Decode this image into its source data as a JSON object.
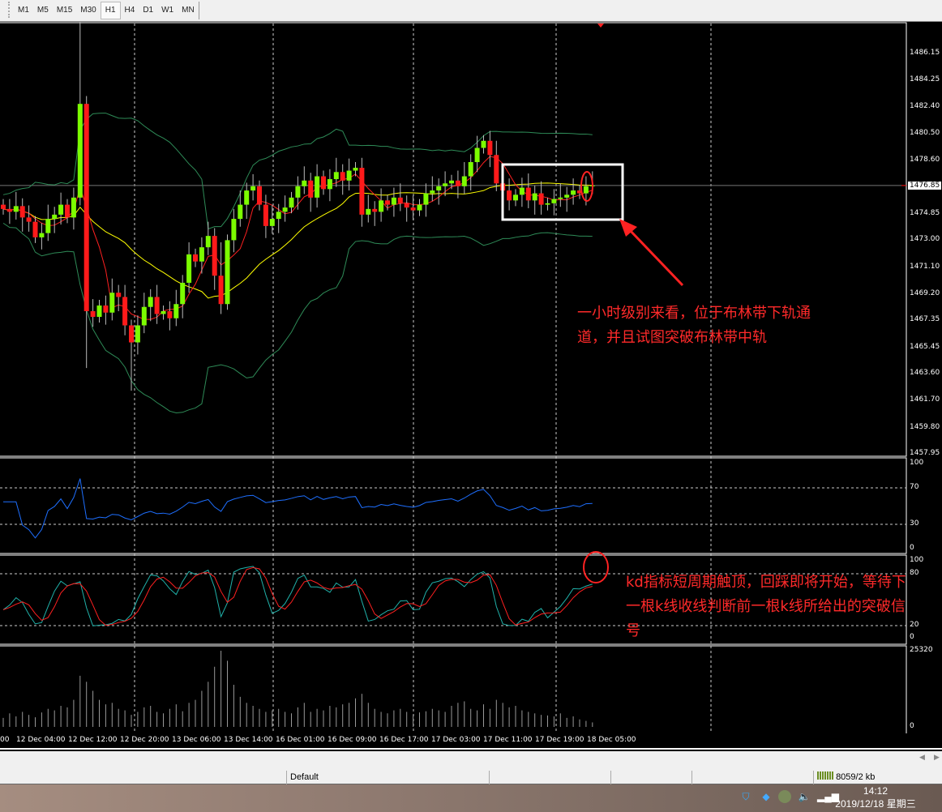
{
  "toolbar": {
    "timeframes": [
      "M1",
      "M5",
      "M15",
      "M30",
      "H1",
      "H4",
      "D1",
      "W1",
      "MN"
    ],
    "active": "H1"
  },
  "price_axis": {
    "labels": [
      "1486.15",
      "1484.25",
      "1482.40",
      "1480.50",
      "1478.60",
      "1474.85",
      "1473.00",
      "1471.10",
      "1469.20",
      "1467.35",
      "1465.45",
      "1463.60",
      "1461.70",
      "1459.80",
      "1457.95"
    ],
    "current": "1476.85"
  },
  "rsi_axis": [
    "100",
    "70",
    "30",
    "0"
  ],
  "stoch_axis": [
    "100",
    "80",
    "20",
    "0"
  ],
  "volume_axis": [
    "25320",
    "0"
  ],
  "time_axis": [
    "00",
    "12 Dec 04:00",
    "12 Dec 12:00",
    "12 Dec 20:00",
    "13 Dec 06:00",
    "13 Dec 14:00",
    "16 Dec 01:00",
    "16 Dec 09:00",
    "16 Dec 17:00",
    "17 Dec 03:00",
    "17 Dec 11:00",
    "17 Dec 19:00",
    "18 Dec 05:00"
  ],
  "annotations": {
    "main": "一小时级别来看，位于布林带下轨通道，并且试图突破布林带中轨",
    "kd": "kd指标短周期触顶，回踩即将开始，等待下一根k线收线判断前一根k线所给出的突破信号"
  },
  "status": {
    "profile": "Default",
    "traffic": "8059/2 kb"
  },
  "taskbar": {
    "time": "14:12",
    "date": "2019/12/18 星期三"
  },
  "colors": {
    "bull": "#7cfc00",
    "bear": "#ff1a1a",
    "bands": "#2e8b57",
    "ma": "#ffff00",
    "fast_ma": "#ff2020",
    "rsi": "#1e6fff",
    "stoch_k": "#20b2aa",
    "stoch_d": "#ff2020",
    "annotation": "#ff2a2a"
  },
  "chart_data": {
    "type": "candlestick",
    "symbol_timeframe": "H1",
    "closes": [
      1475.2,
      1475.0,
      1475.4,
      1474.6,
      1474.3,
      1473.2,
      1473.5,
      1474.5,
      1474.8,
      1475.5,
      1474.6,
      1476.0,
      1482.6,
      1468.0,
      1467.6,
      1468.4,
      1467.9,
      1469.3,
      1469.0,
      1467.0,
      1465.8,
      1467.0,
      1468.3,
      1469.0,
      1467.8,
      1468.0,
      1467.5,
      1468.5,
      1470.0,
      1472.0,
      1471.5,
      1472.5,
      1473.3,
      1470.5,
      1468.5,
      1473.0,
      1474.5,
      1475.5,
      1476.5,
      1476.8,
      1475.5,
      1474.0,
      1474.5,
      1475.0,
      1475.3,
      1476.0,
      1476.8,
      1477.2,
      1476.0,
      1477.5,
      1476.6,
      1477.3,
      1477.8,
      1477.2,
      1477.9,
      1478.1,
      1474.8,
      1475.2,
      1475.0,
      1475.8,
      1475.5,
      1476.0,
      1475.6,
      1475.3,
      1475.1,
      1475.5,
      1476.3,
      1476.5,
      1476.8,
      1477.0,
      1477.2,
      1476.8,
      1477.5,
      1478.5,
      1479.5,
      1480.0,
      1479.0,
      1477.0,
      1476.5,
      1475.8,
      1476.2,
      1476.7,
      1475.8,
      1476.3,
      1475.5,
      1475.6,
      1475.9,
      1476.0,
      1476.2,
      1476.5,
      1476.3,
      1476.8,
      1476.85
    ],
    "volumes": [
      3000,
      4500,
      3500,
      5000,
      4000,
      3200,
      4800,
      6000,
      5500,
      7000,
      6500,
      9000,
      17000,
      15000,
      12000,
      9000,
      7500,
      8000,
      6000,
      5500,
      4000,
      5000,
      6500,
      7000,
      5000,
      4500,
      6000,
      7500,
      5200,
      8000,
      9000,
      12000,
      15000,
      20000,
      25320,
      22000,
      14000,
      10000,
      8000,
      7000,
      6000,
      5000,
      5500,
      6000,
      5000,
      4500,
      6500,
      8000,
      5000,
      6000,
      5500,
      7000,
      6500,
      7500,
      8000,
      9500,
      11000,
      8000,
      6000,
      5000,
      4500,
      5500,
      6000,
      5000,
      4000,
      4800,
      5200,
      6000,
      5500,
      5000,
      7000,
      8000,
      8500,
      6000,
      5500,
      7500,
      6000,
      9000,
      8000,
      6500,
      7000,
      5500,
      5000,
      4500,
      4000,
      3800,
      3500,
      4500,
      3000,
      3500,
      2500,
      2000,
      1500
    ],
    "price_range": [
      1457.95,
      1487.5
    ]
  }
}
